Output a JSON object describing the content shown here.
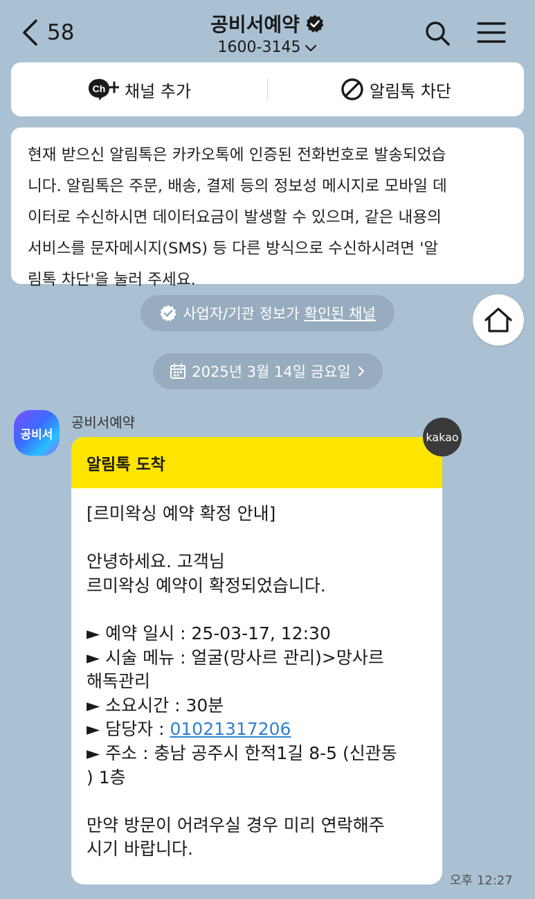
{
  "header": {
    "unread_count": "58",
    "title": "공비서예약",
    "phone": "1600-3145"
  },
  "actions": {
    "add_channel": "채널 추가",
    "block_alimtalk": "알림톡 차단"
  },
  "notice": {
    "lines": [
      "현재 받으신 알림톡은 카카오톡에 인증된 전화번호로 발송되었습",
      "니다. 알림톡은 주문, 배송, 결제 등의 정보성 메시지로 모바일 데",
      "이터로 수신하시면 데이터요금이 발생할 수 있으며, 같은 내용의",
      "서비스를 문자메시지(SMS) 등 다른 방식으로 수신하시려면 '알",
      "림톡 차단'을 눌러 주세요."
    ]
  },
  "verified_pill": {
    "text": "사업자/기관 정보가",
    "link": "확인된 채널"
  },
  "date_pill": {
    "text": "2025년 3월 14일 금요일"
  },
  "message": {
    "avatar_text": "공비서",
    "sender": "공비서예약",
    "header": "알림톡 도착",
    "line1": "[르미왁싱 예약 확정 안내]",
    "line2": "안녕하세요. 고객님",
    "line3": "르미왁싱 예약이 확정되었습니다.",
    "line4": "► 예약 일시 : 25-03-17, 12:30",
    "line5": "► 시술 메뉴 : 얼굴(망사르 관리)>망사르",
    "line6": "해독관리",
    "line7": "► 소요시간 : 30분",
    "line8_prefix": "► 담당자 : ",
    "line8_link": "01021317206",
    "line9": "► 주소 : 충남 공주시 한적1길 8-5 (신관동",
    "line10": ") 1층",
    "line11": "만약 방문이 어려우실 경우 미리 연락해주",
    "line12": "시기 바랍니다.",
    "badge": "kakao",
    "time": "오후 12:27"
  },
  "icons": {
    "back": "chevron-left-icon",
    "verified": "verified-badge-icon",
    "search": "search-icon",
    "menu": "hamburger-menu-icon",
    "channel": "channel-add-icon",
    "block": "block-icon",
    "home": "home-icon",
    "calendar": "calendar-icon"
  },
  "colors": {
    "background": "#aac1d3",
    "bubble_header": "#fee500",
    "link": "#2f7fcf"
  }
}
